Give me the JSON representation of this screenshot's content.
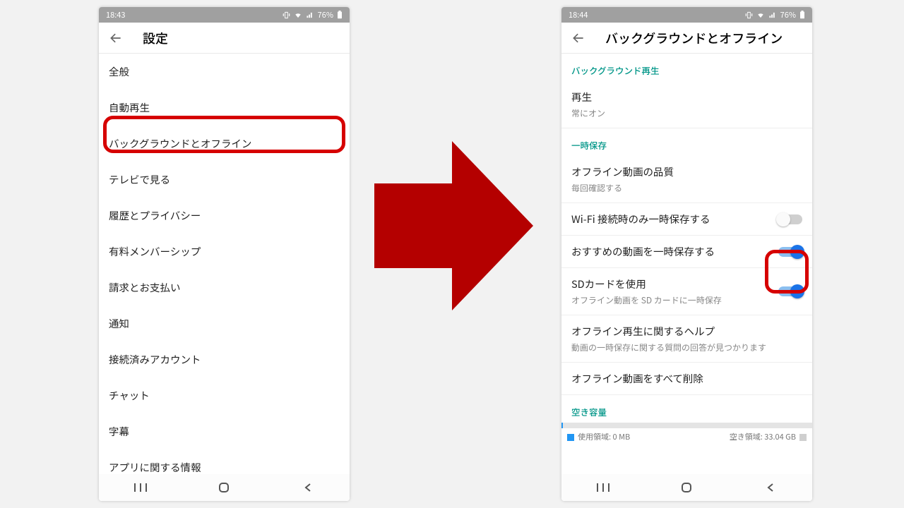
{
  "status": {
    "time_left": "18:43",
    "time_right": "18:44",
    "battery": "76%"
  },
  "arrow_color": "#b40000",
  "highlight_color": "#d60000",
  "screen1": {
    "title": "設定",
    "items": [
      "全般",
      "自動再生",
      "バックグラウンドとオフライン",
      "テレビで見る",
      "履歴とプライバシー",
      "有料メンバーシップ",
      "請求とお支払い",
      "通知",
      "接続済みアカウント",
      "チャット",
      "字幕",
      "アプリに関する情報"
    ],
    "highlight_index": 2
  },
  "screen2": {
    "title": "バックグラウンドとオフライン",
    "sections": {
      "bg_play": "バックグラウンド再生",
      "temp": "一時保存",
      "storage": "空き容量"
    },
    "play": {
      "label": "再生",
      "sub": "常にオン"
    },
    "quality": {
      "label": "オフライン動画の品質",
      "sub": "毎回確認する"
    },
    "wifi_only": {
      "label": "Wi-Fi 接続時のみ一時保存する",
      "on": false
    },
    "recommended": {
      "label": "おすすめの動画を一時保存する",
      "on": true
    },
    "sdcard": {
      "label": "SDカードを使用",
      "sub": "オフライン動画を SD カードに一時保存",
      "on": true
    },
    "help": {
      "label": "オフライン再生に関するヘルプ",
      "sub": "動画の一時保存に関する質問の回答が見つかります"
    },
    "delete_all": {
      "label": "オフライン動画をすべて削除"
    },
    "storage": {
      "used_label": "使用領域: 0 MB",
      "free_label": "空き領域: 33.04 GB"
    }
  }
}
